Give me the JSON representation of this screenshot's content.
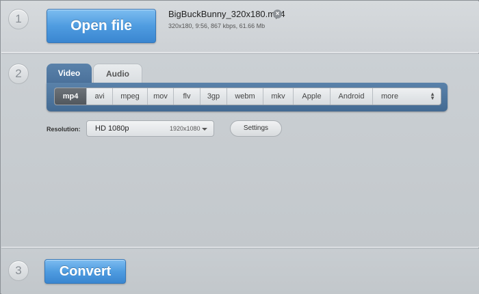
{
  "steps": {
    "step1": "1",
    "step2": "2",
    "step3": "3"
  },
  "open_section": {
    "open_button_label": "Open file",
    "file_name": "BigBuckBunny_320x180.mp4",
    "file_info": "320x180, 9:56, 867 kbps, 61.66 Mb",
    "remove_icon": "close-circle-icon"
  },
  "format_section": {
    "tabs": {
      "video": "Video",
      "audio": "Audio"
    },
    "active_tab": "Video",
    "formats": [
      "mp4",
      "avi",
      "mpeg",
      "mov",
      "flv",
      "3gp",
      "webm",
      "mkv",
      "Apple",
      "Android",
      "more"
    ],
    "selected_format": "mp4",
    "resolution_label": "Resolution:",
    "resolution_value": "HD 1080p",
    "resolution_size": "1920x1080",
    "settings_label": "Settings"
  },
  "convert_section": {
    "convert_button_label": "Convert"
  },
  "colors": {
    "accent_blue": "#4f9ce0",
    "panel_blue": "#4a709a",
    "background": "#c3c8cd"
  }
}
